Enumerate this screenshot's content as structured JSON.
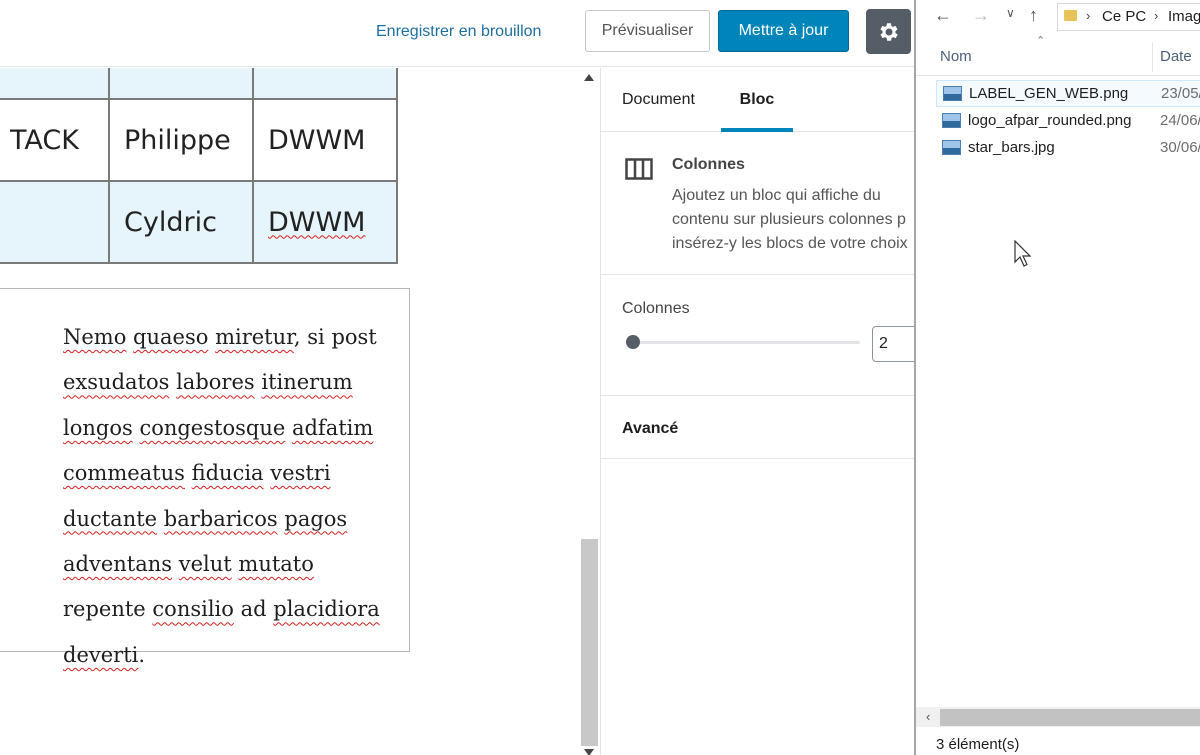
{
  "header": {
    "draft_label": "Enregistrer en brouillon",
    "preview_label": "Prévisualiser",
    "update_label": "Mettre à jour",
    "settings_icon": "gear-icon",
    "update_color": "#0085ba"
  },
  "table": {
    "rows": [
      [
        "",
        "",
        ""
      ],
      [
        "TACK",
        "Philippe",
        "DWWM"
      ],
      [
        "",
        "Cyldric",
        "DWWM"
      ]
    ],
    "stripe_color": "#e6f4fb"
  },
  "paragraph": {
    "text": " Nemo quaeso miretur, si post exsudatos labores itinerum longos congestosque adfatim commeatus fiducia vestri ductante barbaricos pagos adventans velut mutato repente consilio ad placidiora deverti."
  },
  "sidebar": {
    "tabs": [
      "Document",
      "Bloc"
    ],
    "active_tab": "Bloc",
    "block": {
      "icon": "columns-icon",
      "title": "Colonnes",
      "desc_lines": [
        "Ajoutez un bloc qui affiche du",
        "contenu sur plusieurs colonnes p",
        "insérez-y les blocs de votre choix"
      ]
    },
    "columns_panel": {
      "label": "Colonnes",
      "value": "2"
    },
    "advanced_label": "Avancé"
  },
  "explorer": {
    "breadcrumb": [
      "Ce PC",
      "Imag"
    ],
    "columns": {
      "name": "Nom",
      "date": "Date"
    },
    "files": [
      {
        "name": "LABEL_GEN_WEB.png",
        "date": "23/05/",
        "selected": true
      },
      {
        "name": "logo_afpar_rounded.png",
        "date": "24/06/",
        "selected": false
      },
      {
        "name": "star_bars.jpg",
        "date": "30/06/",
        "selected": false
      }
    ],
    "status": "3 élément(s)"
  }
}
